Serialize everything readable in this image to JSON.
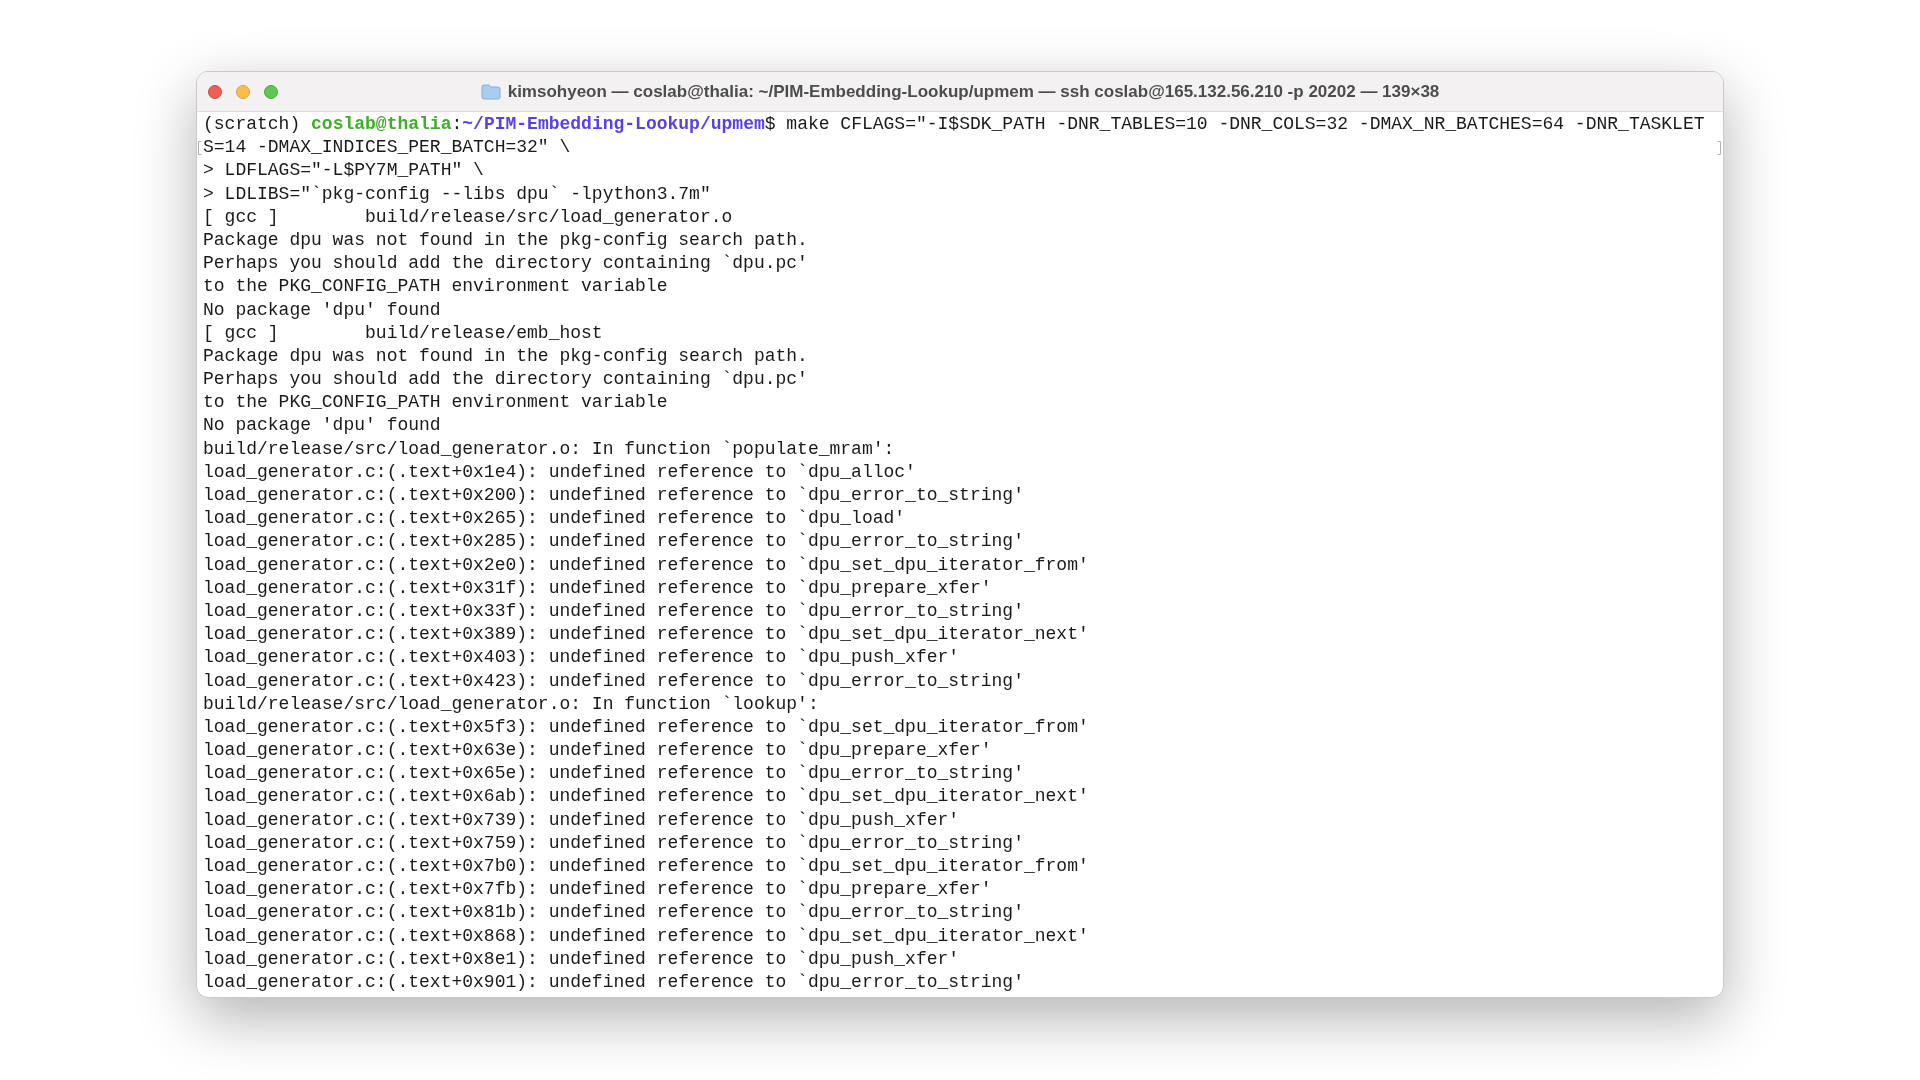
{
  "window": {
    "title": "kimsohyeon — coslab@thalia: ~/PIM-Embedding-Lookup/upmem — ssh coslab@165.132.56.210 -p 20202 — 139×38"
  },
  "terminal": {
    "lines": [
      {
        "kind": "prompt",
        "env": "(scratch) ",
        "user_host": "coslab@thalia",
        "separator": ":",
        "path": "~/PIM-Embedding-Lookup/upmem",
        "command": "$ make CFLAGS=\"-I$SDK_PATH -DNR_TABLES=10 -DNR_COLS=32 -DMAX_NR_BATCHES=64 -DNR_TASKLET"
      },
      {
        "kind": "wrapped",
        "text": "S=14 -DMAX_INDICES_PER_BATCH=32\" \\"
      },
      {
        "kind": "output",
        "text": "> LDFLAGS=\"-L$PY7M_PATH\" \\"
      },
      {
        "kind": "output",
        "text": "> LDLIBS=\"`pkg-config --libs dpu` -lpython3.7m\""
      },
      {
        "kind": "output",
        "text": "[ gcc ]        build/release/src/load_generator.o"
      },
      {
        "kind": "output",
        "text": "Package dpu was not found in the pkg-config search path."
      },
      {
        "kind": "output",
        "text": "Perhaps you should add the directory containing `dpu.pc'"
      },
      {
        "kind": "output",
        "text": "to the PKG_CONFIG_PATH environment variable"
      },
      {
        "kind": "output",
        "text": "No package 'dpu' found"
      },
      {
        "kind": "output",
        "text": "[ gcc ]        build/release/emb_host"
      },
      {
        "kind": "output",
        "text": "Package dpu was not found in the pkg-config search path."
      },
      {
        "kind": "output",
        "text": "Perhaps you should add the directory containing `dpu.pc'"
      },
      {
        "kind": "output",
        "text": "to the PKG_CONFIG_PATH environment variable"
      },
      {
        "kind": "output",
        "text": "No package 'dpu' found"
      },
      {
        "kind": "output",
        "text": "build/release/src/load_generator.o: In function `populate_mram':"
      },
      {
        "kind": "output",
        "text": "load_generator.c:(.text+0x1e4): undefined reference to `dpu_alloc'"
      },
      {
        "kind": "output",
        "text": "load_generator.c:(.text+0x200): undefined reference to `dpu_error_to_string'"
      },
      {
        "kind": "output",
        "text": "load_generator.c:(.text+0x265): undefined reference to `dpu_load'"
      },
      {
        "kind": "output",
        "text": "load_generator.c:(.text+0x285): undefined reference to `dpu_error_to_string'"
      },
      {
        "kind": "output",
        "text": "load_generator.c:(.text+0x2e0): undefined reference to `dpu_set_dpu_iterator_from'"
      },
      {
        "kind": "output",
        "text": "load_generator.c:(.text+0x31f): undefined reference to `dpu_prepare_xfer'"
      },
      {
        "kind": "output",
        "text": "load_generator.c:(.text+0x33f): undefined reference to `dpu_error_to_string'"
      },
      {
        "kind": "output",
        "text": "load_generator.c:(.text+0x389): undefined reference to `dpu_set_dpu_iterator_next'"
      },
      {
        "kind": "output",
        "text": "load_generator.c:(.text+0x403): undefined reference to `dpu_push_xfer'"
      },
      {
        "kind": "output",
        "text": "load_generator.c:(.text+0x423): undefined reference to `dpu_error_to_string'"
      },
      {
        "kind": "output",
        "text": "build/release/src/load_generator.o: In function `lookup':"
      },
      {
        "kind": "output",
        "text": "load_generator.c:(.text+0x5f3): undefined reference to `dpu_set_dpu_iterator_from'"
      },
      {
        "kind": "output",
        "text": "load_generator.c:(.text+0x63e): undefined reference to `dpu_prepare_xfer'"
      },
      {
        "kind": "output",
        "text": "load_generator.c:(.text+0x65e): undefined reference to `dpu_error_to_string'"
      },
      {
        "kind": "output",
        "text": "load_generator.c:(.text+0x6ab): undefined reference to `dpu_set_dpu_iterator_next'"
      },
      {
        "kind": "output",
        "text": "load_generator.c:(.text+0x739): undefined reference to `dpu_push_xfer'"
      },
      {
        "kind": "output",
        "text": "load_generator.c:(.text+0x759): undefined reference to `dpu_error_to_string'"
      },
      {
        "kind": "output",
        "text": "load_generator.c:(.text+0x7b0): undefined reference to `dpu_set_dpu_iterator_from'"
      },
      {
        "kind": "output",
        "text": "load_generator.c:(.text+0x7fb): undefined reference to `dpu_prepare_xfer'"
      },
      {
        "kind": "output",
        "text": "load_generator.c:(.text+0x81b): undefined reference to `dpu_error_to_string'"
      },
      {
        "kind": "output",
        "text": "load_generator.c:(.text+0x868): undefined reference to `dpu_set_dpu_iterator_next'"
      },
      {
        "kind": "output",
        "text": "load_generator.c:(.text+0x8e1): undefined reference to `dpu_push_xfer'"
      },
      {
        "kind": "output",
        "text": "load_generator.c:(.text+0x901): undefined reference to `dpu_error_to_string'"
      }
    ]
  }
}
